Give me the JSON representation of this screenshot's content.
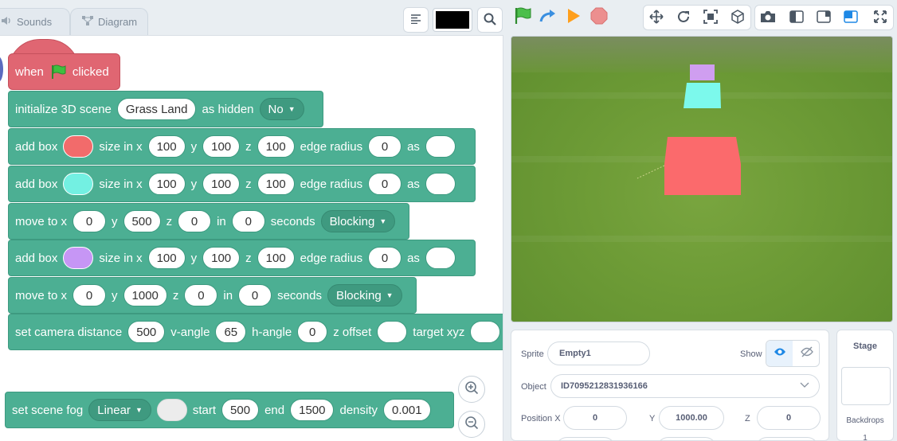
{
  "tabs": [
    {
      "label": "Sounds",
      "icon": "speaker-icon"
    },
    {
      "label": "Diagram",
      "icon": "diagram-icon"
    }
  ],
  "code_toolbar": {
    "pen_color": "#000000"
  },
  "blocks": {
    "hat": {
      "when": "when",
      "clicked": "clicked"
    },
    "init_scene": {
      "label": "initialize 3D scene",
      "scene": "Grass Land",
      "as_hidden": "as hidden",
      "hidden_value": "No"
    },
    "box1": {
      "label": "add box",
      "color": "#f26b6b",
      "size_label": "size in x",
      "x": "100",
      "y_label": "y",
      "y": "100",
      "z_label": "z",
      "z": "100",
      "edge_label": "edge radius",
      "edge": "0",
      "as_label": "as",
      "as_value": ""
    },
    "box2": {
      "label": "add box",
      "color": "#73f0e2",
      "size_label": "size in x",
      "x": "100",
      "y_label": "y",
      "y": "100",
      "z_label": "z",
      "z": "100",
      "edge_label": "edge radius",
      "edge": "0",
      "as_label": "as",
      "as_value": ""
    },
    "move1": {
      "label": "move to x",
      "x": "0",
      "y_label": "y",
      "y": "500",
      "z_label": "z",
      "z": "0",
      "in_label": "in",
      "in": "0",
      "seconds": "seconds",
      "mode": "Blocking"
    },
    "box3": {
      "label": "add box",
      "color": "#c696f5",
      "size_label": "size in x",
      "x": "100",
      "y_label": "y",
      "y": "100",
      "z_label": "z",
      "z": "100",
      "edge_label": "edge radius",
      "edge": "0",
      "as_label": "as",
      "as_value": ""
    },
    "move2": {
      "label": "move to x",
      "x": "0",
      "y_label": "y",
      "y": "1000",
      "z_label": "z",
      "z": "0",
      "in_label": "in",
      "in": "0",
      "seconds": "seconds",
      "mode": "Blocking"
    },
    "camera": {
      "label": "set camera distance",
      "distance": "500",
      "v_label": "v-angle",
      "v": "65",
      "h_label": "h-angle",
      "h": "0",
      "z_label": "z offset",
      "z": "",
      "target_label": "target xyz"
    },
    "fog": {
      "label": "set scene fog",
      "mode": "Linear",
      "color": "",
      "start_label": "start",
      "start": "500",
      "end_label": "end",
      "end": "1500",
      "density_label": "density",
      "density": "0.001"
    }
  },
  "stage_boxes": [
    {
      "name": "red box",
      "color": "#fb6a6c"
    },
    {
      "name": "cyan box",
      "color": "#7cf9ec"
    },
    {
      "name": "purple box",
      "color": "#cf9ef0"
    }
  ],
  "sprite_panel": {
    "sprite_label": "Sprite",
    "sprite_name": "Empty1",
    "show_label": "Show",
    "object_label": "Object",
    "object_id": "ID7095212831936166",
    "position_x_label": "Position X",
    "position_x": "0",
    "y_label": "Y",
    "y": "1000.00",
    "z_label": "Z",
    "z": "0"
  },
  "stage_panel": {
    "title": "Stage",
    "backdrops_label": "Backdrops",
    "backdrops_count": "1"
  }
}
